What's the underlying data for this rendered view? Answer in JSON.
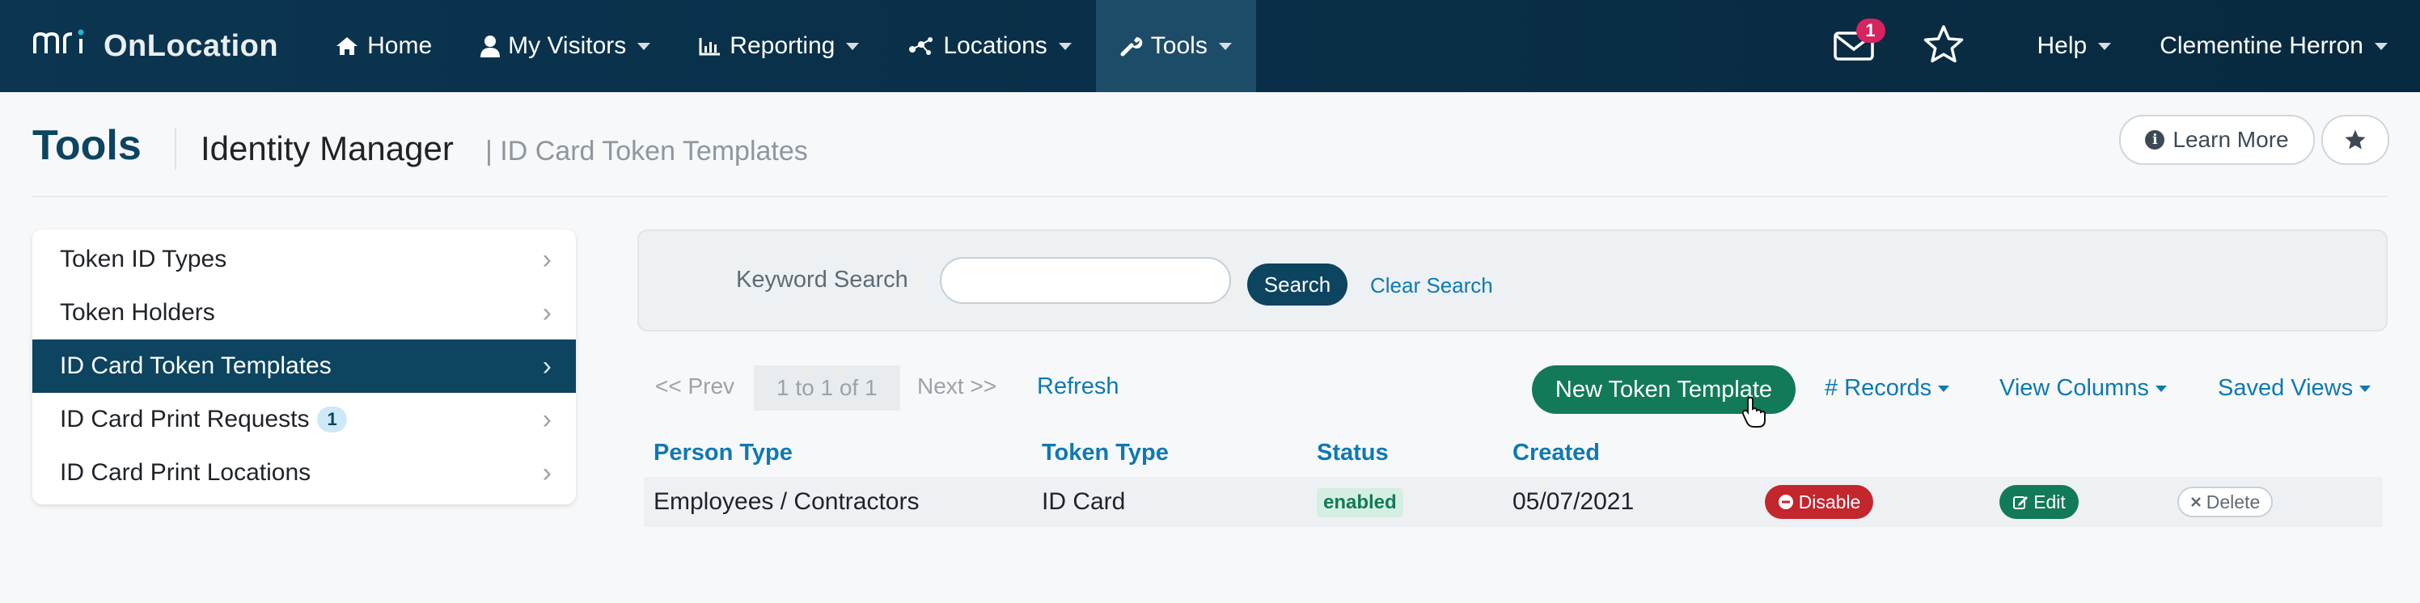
{
  "brand": {
    "logo": "mri",
    "product": "OnLocation"
  },
  "nav": {
    "items": [
      {
        "label": "Home",
        "icon": "home-icon",
        "dropdown": false
      },
      {
        "label": "My Visitors",
        "icon": "user-icon",
        "dropdown": true
      },
      {
        "label": "Reporting",
        "icon": "chart-icon",
        "dropdown": true
      },
      {
        "label": "Locations",
        "icon": "network-icon",
        "dropdown": true
      },
      {
        "label": "Tools",
        "icon": "wrench-icon",
        "dropdown": true,
        "active": true
      }
    ],
    "mail_count": "1",
    "help_label": "Help",
    "user_name": "Clementine Herron"
  },
  "header": {
    "title": "Tools",
    "module": "Identity Manager",
    "separator": "|",
    "page": "ID Card Token Templates",
    "learn_more": "Learn More"
  },
  "sidebar": {
    "items": [
      {
        "label": "Token ID Types"
      },
      {
        "label": "Token Holders"
      },
      {
        "label": "ID Card Token Templates",
        "active": true
      },
      {
        "label": "ID Card Print Requests",
        "badge": "1"
      },
      {
        "label": "ID Card Print Locations"
      }
    ]
  },
  "search": {
    "label": "Keyword Search",
    "value": "",
    "button": "Search",
    "clear": "Clear Search"
  },
  "toolbar": {
    "prev": "<< Prev",
    "pager": "1 to 1 of 1",
    "next": "Next >>",
    "refresh": "Refresh",
    "new_template": "New Token Template",
    "records": "# Records",
    "view_columns": "View Columns",
    "saved_views": "Saved Views"
  },
  "table": {
    "columns": [
      "Person Type",
      "Token Type",
      "Status",
      "Created"
    ],
    "rows": [
      {
        "person_type": "Employees / Contractors",
        "token_type": "ID Card",
        "status": "enabled",
        "created": "05/07/2021",
        "actions": {
          "disable": "Disable",
          "edit": "Edit",
          "delete": "Delete"
        }
      }
    ]
  },
  "colors": {
    "nav_bg": "#0b3550",
    "primary": "#0d4460",
    "link": "#0e79b2",
    "success": "#127a58",
    "danger": "#c4262e",
    "badge": "#d6245e"
  }
}
